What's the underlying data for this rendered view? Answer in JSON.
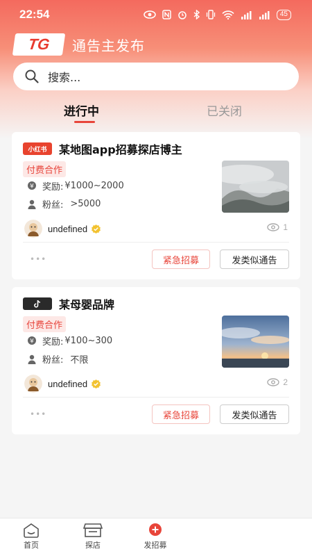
{
  "status_bar": {
    "time": "22:54",
    "battery": "45"
  },
  "header": {
    "logo_text": "TG",
    "title": "通告主发布"
  },
  "search": {
    "placeholder": "搜索..."
  },
  "tabs": [
    {
      "label": "进行中",
      "active": true
    },
    {
      "label": "已关闭",
      "active": false
    }
  ],
  "cards": [
    {
      "platform_badge": "小红书",
      "title": "某地图app招募探店博主",
      "tag": "付费合作",
      "reward_label": "奖励:",
      "reward_value": "¥1000~2000",
      "fans_label": "粉丝:",
      "fans_value": ">5000",
      "username": "undefined",
      "views": "1",
      "more": "•••",
      "btn_urgent": "紧急招募",
      "btn_similar": "发类似通告",
      "thumb_icon": "misty-mountain-image"
    },
    {
      "platform_badge": "tiktok-icon",
      "title": "某母婴品牌",
      "tag": "付费合作",
      "reward_label": "奖励:",
      "reward_value": "¥100~300",
      "fans_label": "粉丝:",
      "fans_value": "不限",
      "username": "undefined",
      "views": "2",
      "more": "•••",
      "btn_urgent": "紧急招募",
      "btn_similar": "发类似通告",
      "thumb_icon": "sunset-sky-image"
    }
  ],
  "bottom_nav": [
    {
      "label": "首页",
      "icon": "home-icon"
    },
    {
      "label": "探店",
      "icon": "shop-icon"
    },
    {
      "label": "发招募",
      "icon": "publish-icon"
    }
  ],
  "colors": {
    "accent": "#e8453a",
    "header_gradient_top": "#f46a5e"
  }
}
